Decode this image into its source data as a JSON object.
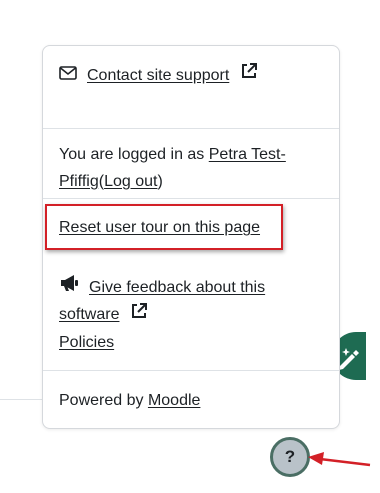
{
  "popover": {
    "contact": {
      "label": "Contact site support",
      "icon": "envelope-icon",
      "external_icon": "external-link-icon"
    },
    "login": {
      "prefix": "You are logged in as ",
      "user_name": "Petra Test-Pfiffig",
      "open_paren": " (",
      "logout_label": "Log out",
      "close_paren": ")"
    },
    "reset_tour": {
      "label": "Reset user tour on this page"
    },
    "feedback": {
      "icon": "bullhorn-icon",
      "label": "Give feedback about this software",
      "external_icon": "external-link-icon"
    },
    "policies": {
      "label": "Policies"
    },
    "footer": {
      "prefix": "Powered by ",
      "link": "Moodle"
    }
  },
  "help_button": {
    "label": "?"
  },
  "colors": {
    "highlight": "#d32027",
    "fab_green": "#1e6b52",
    "help_bg": "#b9c2c9",
    "help_border": "#4a6e64",
    "annotation_arrow": "#d32027"
  }
}
